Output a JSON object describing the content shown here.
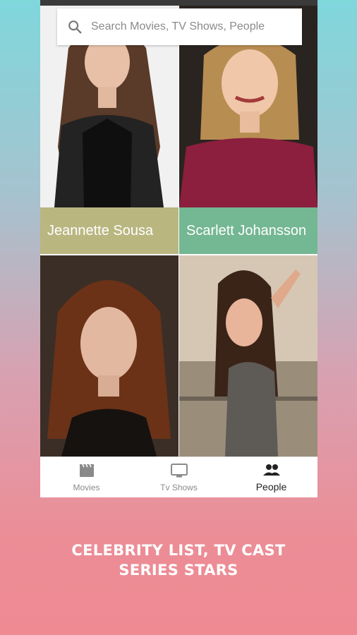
{
  "search": {
    "placeholder": "Search Movies, TV Shows, People"
  },
  "people": [
    {
      "name": "Jeannette Sousa",
      "caption_color": "#b9b680"
    },
    {
      "name": "Scarlett Johansson",
      "caption_color": "#74b793"
    },
    {
      "name": "",
      "caption_color": ""
    },
    {
      "name": "",
      "caption_color": ""
    }
  ],
  "bottom_nav": {
    "items": [
      {
        "label": "Movies",
        "icon": "movie-clapper-icon",
        "active": false
      },
      {
        "label": "Tv Shows",
        "icon": "tv-icon",
        "active": false
      },
      {
        "label": "People",
        "icon": "people-icon",
        "active": true
      }
    ]
  },
  "tagline": {
    "line1": "CELEBRITY LIST, TV CAST",
    "line2": "SERIES STARS"
  }
}
